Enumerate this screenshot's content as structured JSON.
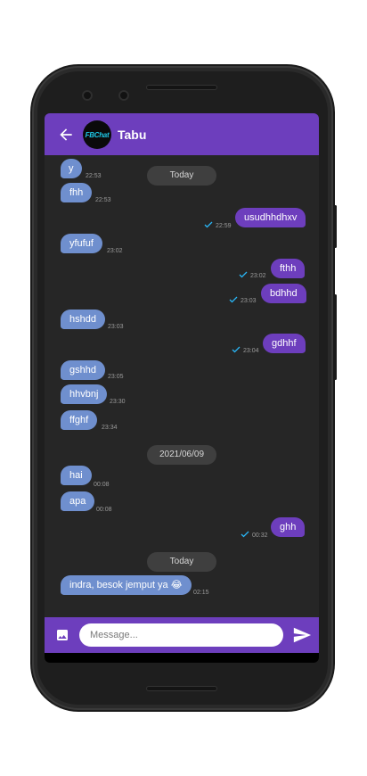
{
  "header": {
    "title": "Tabu",
    "avatar_text": "FBChat"
  },
  "composer": {
    "placeholder": "Message..."
  },
  "dates": [
    "Today",
    "2021/06/09",
    "Today"
  ],
  "messages": [
    {
      "text": "y",
      "time": "22:53"
    },
    {
      "text": "fhh",
      "time": "22:53"
    },
    {
      "text": "usudhhdhxv",
      "time": "22:59"
    },
    {
      "text": "yfufuf",
      "time": "23:02"
    },
    {
      "text": "fthh",
      "time": "23:02"
    },
    {
      "text": "bdhhd",
      "time": "23:03"
    },
    {
      "text": "hshdd",
      "time": "23:03"
    },
    {
      "text": "gdhhf",
      "time": "23:04"
    },
    {
      "text": "gshhd",
      "time": "23:05"
    },
    {
      "text": "hhvbnj",
      "time": "23:30"
    },
    {
      "text": "ffghf",
      "time": "23:34"
    },
    {
      "text": "hai",
      "time": "00:08"
    },
    {
      "text": "apa",
      "time": "00:08"
    },
    {
      "text": "ghh",
      "time": "00:32"
    },
    {
      "text": "indra, besok jemput ya 😂",
      "time": "02:15"
    }
  ],
  "colors": {
    "appbar": "#6d3ebd",
    "incoming": "#6f8fce",
    "outgoing": "#6d3ebd",
    "background": "#262626",
    "check": "#29b6f6"
  },
  "icons": [
    "back-arrow-icon",
    "image-icon",
    "send-icon",
    "double-check-icon"
  ]
}
